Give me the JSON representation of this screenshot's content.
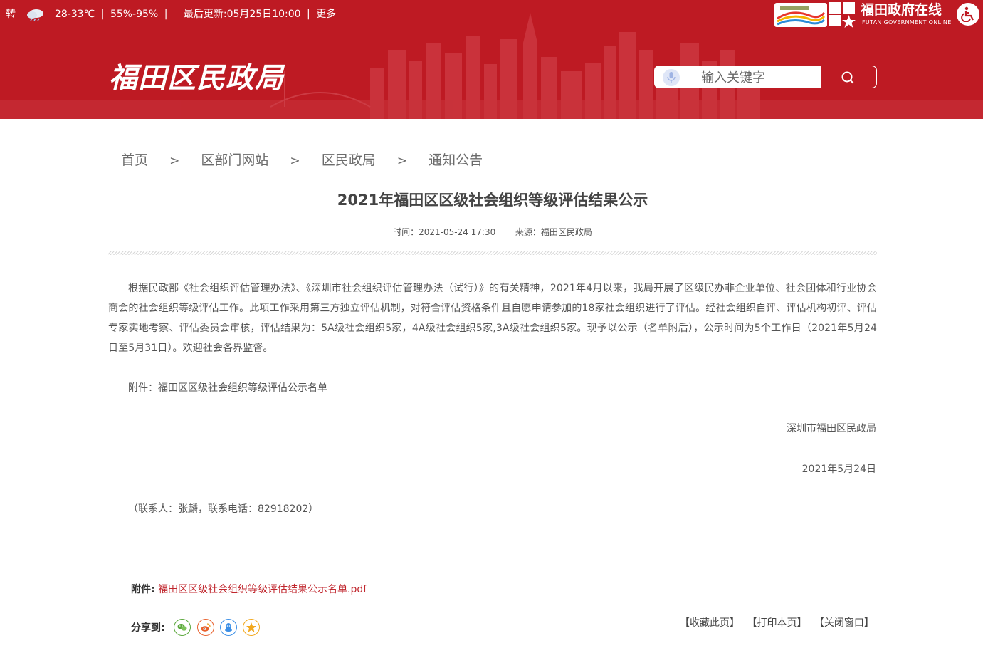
{
  "topbar": {
    "weather_partial": "转",
    "weather_icon": "cloud-rain-icon",
    "temperature": "28-33℃",
    "humidity": "55%-95%",
    "separator": "|",
    "updated": "最后更新:05月25日10:00",
    "more": "更多"
  },
  "gov_logo": {
    "title": "福田政府在线",
    "subtitle": "FUTAN GOVERNMENT ONLINE"
  },
  "site": {
    "title": "福田区民政局"
  },
  "search": {
    "placeholder": "输入关键字"
  },
  "breadcrumb": {
    "items": [
      "首页",
      "区部门网站",
      "区民政局",
      "通知公告"
    ],
    "separator": ">"
  },
  "article": {
    "title": "2021年福田区区级社会组织等级评估结果公示",
    "time_label": "时间：2021-05-24 17:30",
    "source_label": "来源：福田区民政局",
    "body": "根据民政部《社会组织评估管理办法》、《深圳市社会组织评估管理办法（试行）》的有关精神，2021年4月以来，我局开展了区级民办非企业单位、社会团体和行业协会商会的社会组织等级评估工作。此项工作采用第三方独立评估机制，对符合评估资格条件且自愿申请参加的18家社会组织进行了评估。经社会组织自评、评估机构初评、评估专家实地考察、评估委员会审核，评估结果为：5A级社会组织5家，4A级社会组织5家,3A级社会组织5家。现予以公示（名单附后），公示时间为5个工作日（2021年5月24日至5月31日）。欢迎社会各界监督。",
    "attachment_note": "附件：福田区区级社会组织等级评估公示名单",
    "signature": "深圳市福田区民政局",
    "sign_date": "2021年5月24日",
    "contact": "（联系人：张麟，联系电话：82918202）"
  },
  "attachment": {
    "label": "附件:",
    "file_name": "福田区区级社会组织等级评估结果公示名单.pdf"
  },
  "share": {
    "label": "分享到:",
    "icons": [
      {
        "name": "wechat-icon",
        "color": "#5aa73b"
      },
      {
        "name": "weibo-icon",
        "color": "#e8602c"
      },
      {
        "name": "qq-icon",
        "color": "#3a8ee6"
      },
      {
        "name": "qzone-star-icon",
        "color": "#f2a81d"
      }
    ]
  },
  "page_actions": {
    "bookmark": "【收藏此页】",
    "print": "【打印本页】",
    "close": "【关闭窗口】"
  },
  "colors": {
    "brand_red": "#be1a23",
    "link_red": "#c0262d"
  }
}
